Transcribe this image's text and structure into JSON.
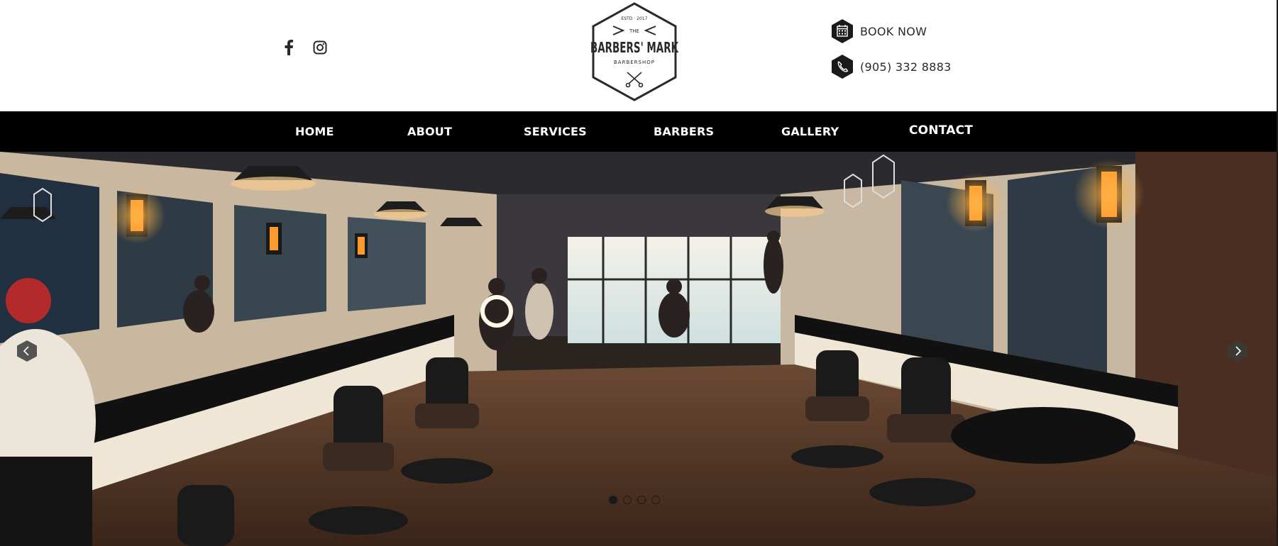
{
  "header": {
    "social": [
      {
        "icon": "facebook-icon"
      },
      {
        "icon": "instagram-icon"
      }
    ],
    "logo": {
      "estd": "ESTD · 2017",
      "the": "THE",
      "name": "BARBERS' MARK",
      "sub": "BARBERSHOP"
    },
    "book_now": {
      "label": "BOOK NOW",
      "icon": "calendar-icon"
    },
    "phone": {
      "label": "(905) 332 8883",
      "icon": "phone-icon"
    }
  },
  "nav": {
    "items": [
      "HOME",
      "ABOUT",
      "SERVICES",
      "BARBERS",
      "GALLERY",
      "CONTACT"
    ]
  },
  "hero": {
    "slide_count": 4,
    "active_slide": 1
  },
  "colors": {
    "nav_bg": "#000000",
    "nav_text": "#ffffff",
    "header_bg": "#ffffff",
    "text_dark": "#2a2a2a"
  }
}
